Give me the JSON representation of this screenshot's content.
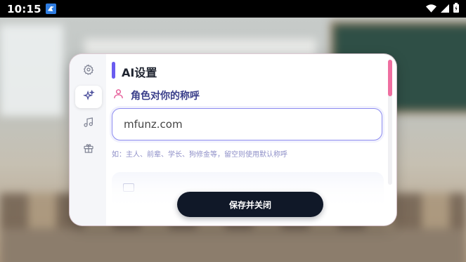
{
  "status_bar": {
    "time": "10:15",
    "app_icon": "bird-icon",
    "wifi_icon": "wifi-icon",
    "signal_icon": "signal-icon",
    "battery_icon": "battery-icon"
  },
  "sidebar": {
    "items": [
      {
        "icon": "gear-icon",
        "active": false
      },
      {
        "icon": "sparkle-icon",
        "active": true
      },
      {
        "icon": "music-icon",
        "active": false
      },
      {
        "icon": "gift-icon",
        "active": false
      }
    ]
  },
  "main": {
    "title": "AI设置",
    "section_label": "角色对你的称呼",
    "section_icon": "user-icon",
    "name_value": "mfunz.com",
    "hint": "如：主人、前辈、学长、狗修金等，留空则使用默认称呼"
  },
  "footer": {
    "save_label": "保存并关闭"
  },
  "colors": {
    "accent": "#6a5cf0",
    "scroll_thumb": "#ef6fa0",
    "button_bg": "#101828",
    "label": "#3a3f8a"
  }
}
